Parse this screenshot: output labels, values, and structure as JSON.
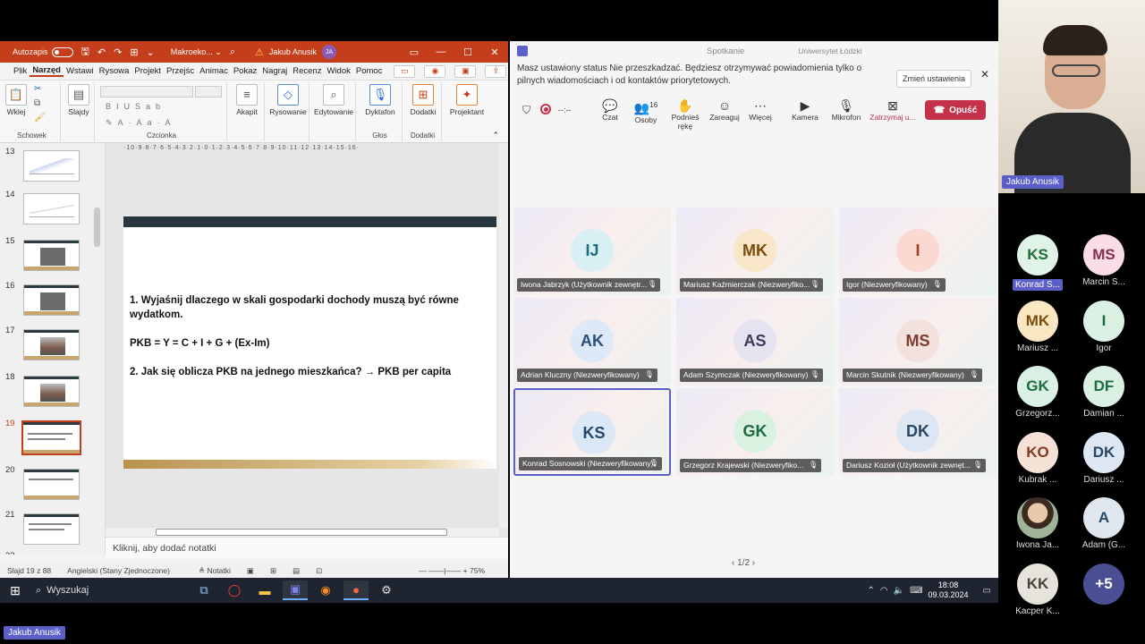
{
  "ppt": {
    "autosave_label": "Autozapis",
    "doc_title": "Makroeko... ⌄",
    "user_name": "Jakub Anusik",
    "user_initials": "JA",
    "tabs": [
      "Plik",
      "Narzęd",
      "Wstawi",
      "Rysowa",
      "Projekt",
      "Przejśc",
      "Animac",
      "Pokaz",
      "Nagraj",
      "Recenz",
      "Widok",
      "Pomoc"
    ],
    "ribbon": {
      "paste_label": "Wklej",
      "clipboard_group": "Schowek",
      "slides_label": "Slajdy",
      "font_group": "Czcionka",
      "paragraph_label": "Akapit",
      "drawing_label": "Rysowanie",
      "editing_label": "Edytowanie",
      "dictation_label": "Dyktafon",
      "voice_group": "Głos",
      "addins_label": "Dodatki",
      "addins_group": "Dodatki",
      "designer_label": "Projektant"
    },
    "thumbnails": [
      "13",
      "14",
      "15",
      "16",
      "17",
      "18",
      "19",
      "20",
      "21",
      "22"
    ],
    "selected_slide": "19",
    "ruler_h": "·10·9·8·7·6·5·4·3·2·1·0·1·2·3·4·5·6·7·8·9·10·11·12·13·14·15·16·",
    "slide": {
      "line1": "1. Wyjaśnij dlaczego w skali gospodarki dochody muszą być równe",
      "line2": "wydatkom.",
      "line3": "PKB = Y = C + I + G + (Ex-Im)",
      "line4": "2. Jak się oblicza PKB na jednego mieszkańca? → PKB per capita"
    },
    "notes_placeholder": "Kliknij, aby dodać notatki",
    "status": {
      "slide_count": "Slajd 19 z 88",
      "language": "Angielski (Stany Zjednoczone)",
      "notes_btn": "Notatki",
      "zoom": "75%"
    }
  },
  "teams": {
    "window_title": "Spotkanie",
    "org": "Uniwersytet Łódzki",
    "notice_text": "Masz ustawiony status Nie przeszkadzać. Będziesz otrzymywać powiadomienia tylko o pilnych wiadomościach i od kontaktów priorytetowych.",
    "notice_button": "Zmień ustawienia",
    "timer": "--:--",
    "toolbar": {
      "chat": "Czat",
      "people": "Osoby",
      "people_count": "16",
      "raise_hand": "Podnieś rękę",
      "react": "Zareaguj",
      "more": "Więcej",
      "camera": "Kamera",
      "mic": "Mikrofon",
      "stop_share": "Zatrzymaj u...",
      "leave": "Opuść"
    },
    "tiles": [
      {
        "initials": "IJ",
        "name": "Iwona Jabrzyk (Użytkownik zewnętr...",
        "bg": "#d8f0f4",
        "fg": "#1b6c7d"
      },
      {
        "initials": "MK",
        "name": "Mariusz Kaźmierczak (Niezweryfiko...",
        "bg": "#f9e6c8",
        "fg": "#7a4c0e"
      },
      {
        "initials": "I",
        "name": "Igor (Niezweryfikowany)",
        "bg": "#fbd9d2",
        "fg": "#a33a22"
      },
      {
        "initials": "AK",
        "name": "Adrian Kluczny (Niezweryfikowany)",
        "bg": "#dde9f6",
        "fg": "#2a4f7a"
      },
      {
        "initials": "AS",
        "name": "Adam Szymczak (Niezweryfikowany)",
        "bg": "#e4e3ef",
        "fg": "#3d3a5e"
      },
      {
        "initials": "MS",
        "name": "Marcin Skutnik (Niezweryfikowany)",
        "bg": "#f2e1dc",
        "fg": "#7e3c30"
      },
      {
        "initials": "KS",
        "name": "Konrad Sosnowski (Niezweryfikowany)",
        "bg": "#dce8f6",
        "fg": "#23486e"
      },
      {
        "initials": "GK",
        "name": "Grzegorz Krajewski (Niezweryfiko...",
        "bg": "#d8f1e1",
        "fg": "#1e6b3d"
      },
      {
        "initials": "DK",
        "name": "Dariusz Kozioł (Użytkownik zewnęt...",
        "bg": "#dce7f3",
        "fg": "#2a4765"
      }
    ],
    "pager": "1/2"
  },
  "speaker_label": "Jakub Anusik",
  "gallery": [
    {
      "initials": "KS",
      "label": "Konrad S...",
      "bg": "#dff3e6",
      "fg": "#1f6b3a",
      "hl": true
    },
    {
      "initials": "MS",
      "label": "Marcin S...",
      "bg": "#fadde6",
      "fg": "#8a2d4d",
      "hl": false
    },
    {
      "initials": "MK",
      "label": "Mariusz ...",
      "bg": "#f8e7c0",
      "fg": "#7a4c0e",
      "hl": false
    },
    {
      "initials": "I",
      "label": "Igor",
      "bg": "#d9f0e3",
      "fg": "#1e6b3d",
      "hl": false
    },
    {
      "initials": "GK",
      "label": "Grzegorz...",
      "bg": "#d9f0e3",
      "fg": "#1e6b3d",
      "hl": false
    },
    {
      "initials": "DF",
      "label": "Damian ...",
      "bg": "#d9f0e3",
      "fg": "#1e6b3d",
      "hl": false
    },
    {
      "initials": "KO",
      "label": "Kubrak ...",
      "bg": "#f6e1d6",
      "fg": "#7e3c20",
      "hl": false
    },
    {
      "initials": "DK",
      "label": "Dariusz ...",
      "bg": "#dce7f3",
      "fg": "#2a4765",
      "hl": false
    },
    {
      "initials": "",
      "label": "Iwona Ja...",
      "bg": "#cfd8c8",
      "fg": "#333",
      "hl": false
    },
    {
      "initials": "A",
      "label": "Adam (G...",
      "bg": "#dfe6ee",
      "fg": "#2a4765",
      "hl": false
    },
    {
      "initials": "KK",
      "label": "Kacper K...",
      "bg": "#e6e2dc",
      "fg": "#4a4238",
      "hl": false
    },
    {
      "initials": "+5",
      "label": "",
      "bg": "#4a4f94",
      "fg": "#ffffff",
      "hl": false
    }
  ],
  "taskbar": {
    "search_label": "Wyszukaj",
    "time": "18:08",
    "date": "09.03.2024"
  },
  "bottom_label": "Jakub Anusik"
}
